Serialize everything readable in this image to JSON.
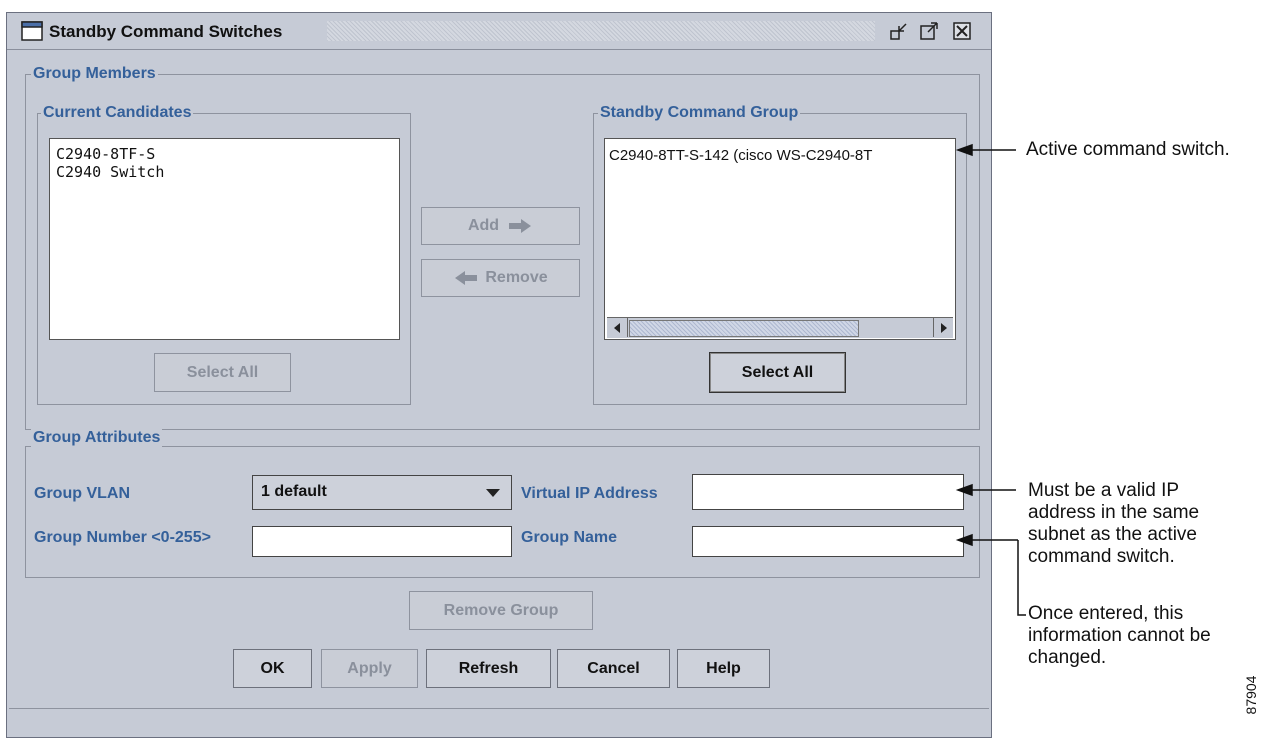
{
  "window": {
    "title": "Standby Command Switches"
  },
  "group_members": {
    "legend": "Group Members",
    "current_candidates": {
      "legend": "Current Candidates",
      "items": [
        "C2940-8TF-S",
        "C2940 Switch"
      ],
      "select_all_label": "Select All"
    },
    "add_label": "Add",
    "remove_label": "Remove",
    "standby_group": {
      "legend": "Standby Command Group",
      "items": [
        "C2940-8TT-S-142 (cisco WS-C2940-8T"
      ],
      "select_all_label": "Select All"
    }
  },
  "group_attributes": {
    "legend": "Group Attributes",
    "vlan_label": "Group VLAN",
    "vlan_value": "1 default",
    "number_label": "Group Number <0-255>",
    "number_value": "",
    "vip_label": "Virtual IP Address",
    "vip_value": "",
    "name_label": "Group Name",
    "name_value": ""
  },
  "remove_group_label": "Remove Group",
  "footer_buttons": {
    "ok": "OK",
    "apply": "Apply",
    "refresh": "Refresh",
    "cancel": "Cancel",
    "help": "Help"
  },
  "annotations": {
    "active": "Active command switch.",
    "vip_1": "Must be a valid IP",
    "vip_2": "address in the same",
    "vip_3": "subnet as the active",
    "vip_4": "command switch.",
    "name_1": "Once entered, this",
    "name_2": "information cannot be",
    "name_3": "changed."
  },
  "figure_number": "87904"
}
